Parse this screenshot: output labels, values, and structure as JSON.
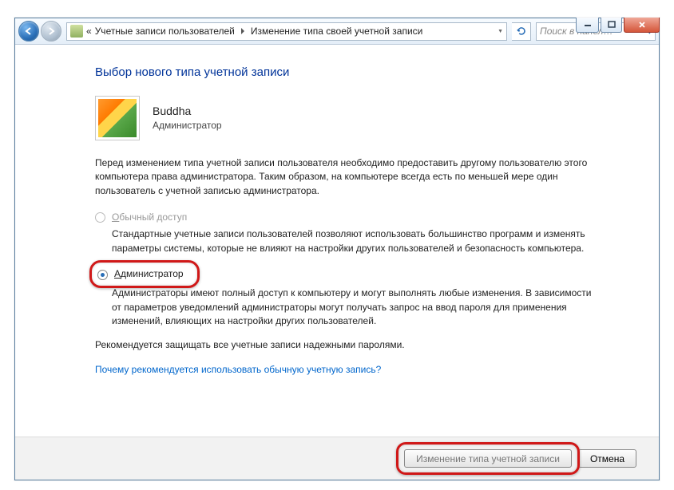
{
  "titlebar": {
    "min": "–",
    "max": "❐",
    "close": "✕"
  },
  "nav": {
    "back": "←",
    "forward": "→",
    "crumb_prefix": "«",
    "crumb1": "Учетные записи пользователей",
    "crumb2": "Изменение типа своей учетной записи",
    "search_placeholder": "Поиск в панел…",
    "refresh": "↻"
  },
  "heading": "Выбор нового типа учетной записи",
  "account": {
    "name": "Buddha",
    "role": "Администратор"
  },
  "intro": "Перед изменением типа учетной записи пользователя необходимо предоставить другому пользователю этого компьютера права администратора. Таким образом, на компьютере всегда есть по меньшей мере один пользователь с учетной записью администратора.",
  "option_standard": {
    "label_u": "О",
    "label_rest": "бычный доступ",
    "desc": "Стандартные учетные записи пользователей позволяют использовать большинство программ и изменять параметры системы, которые не влияют на настройки других пользователей и безопасность компьютера."
  },
  "option_admin": {
    "label_u": "А",
    "label_rest": "дминистратор",
    "desc": "Администраторы имеют полный доступ к компьютеру и могут выполнять любые изменения. В зависимости от параметров уведомлений администраторы могут получать запрос на ввод пароля для применения изменений, влияющих на настройки других пользователей."
  },
  "recommendation": "Рекомендуется защищать все учетные записи надежными паролями.",
  "link_text": "Почему рекомендуется использовать обычную учетную запись?",
  "buttons": {
    "change": "Изменение типа учетной записи",
    "cancel": "Отмена"
  }
}
